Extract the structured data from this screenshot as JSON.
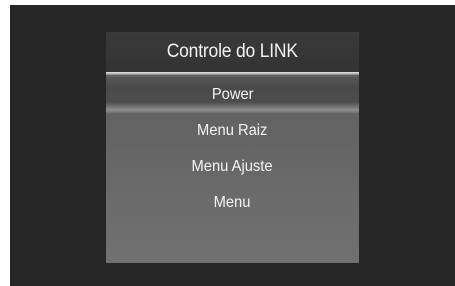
{
  "dialog": {
    "title": "Controle do LINK"
  },
  "menu": {
    "items": [
      {
        "label": "Power",
        "selected": true
      },
      {
        "label": "Menu Raiz",
        "selected": false
      },
      {
        "label": "Menu Ajuste",
        "selected": false
      },
      {
        "label": "Menu",
        "selected": false
      }
    ]
  }
}
